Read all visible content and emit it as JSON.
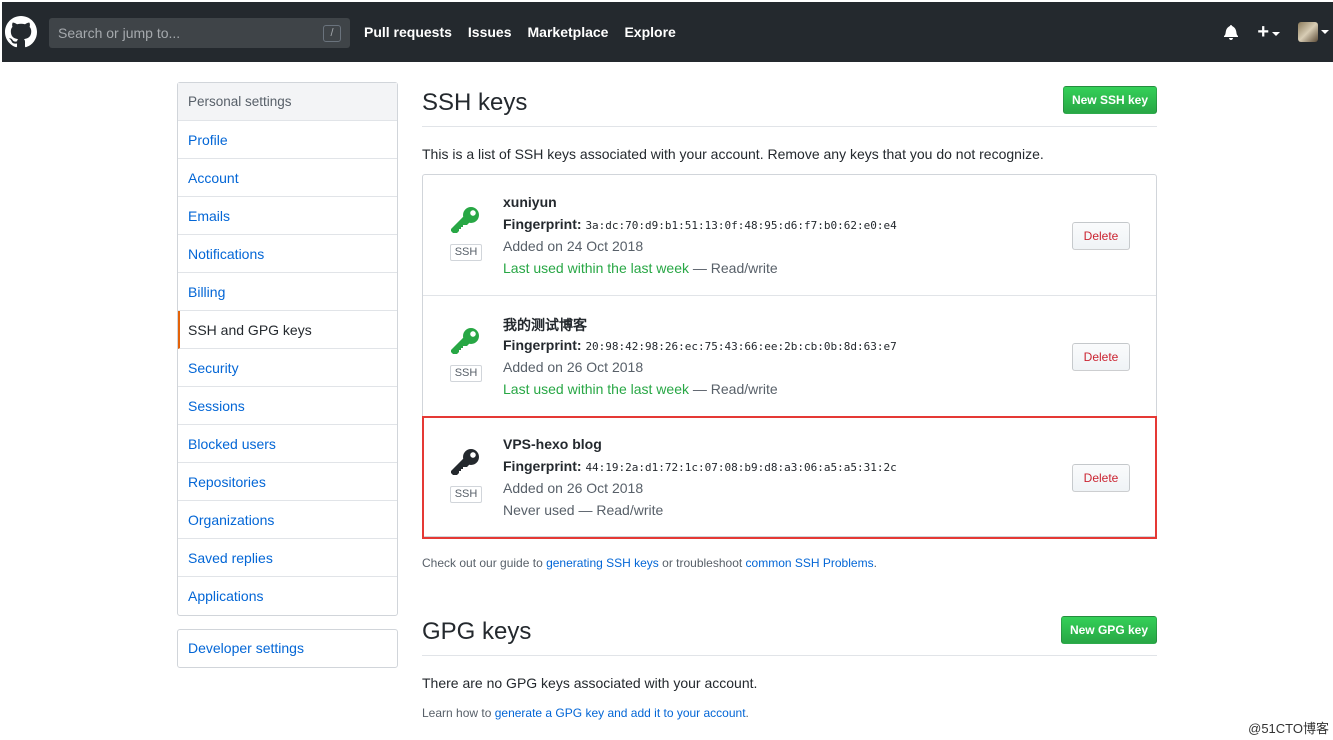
{
  "header": {
    "search_placeholder": "Search or jump to...",
    "slash_key": "/",
    "nav": [
      "Pull requests",
      "Issues",
      "Marketplace",
      "Explore"
    ],
    "plus_label": "+"
  },
  "sidebar": {
    "heading": "Personal settings",
    "items": [
      {
        "label": "Profile"
      },
      {
        "label": "Account"
      },
      {
        "label": "Emails"
      },
      {
        "label": "Notifications"
      },
      {
        "label": "Billing"
      },
      {
        "label": "SSH and GPG keys",
        "selected": true
      },
      {
        "label": "Security"
      },
      {
        "label": "Sessions"
      },
      {
        "label": "Blocked users"
      },
      {
        "label": "Repositories"
      },
      {
        "label": "Organizations"
      },
      {
        "label": "Saved replies"
      },
      {
        "label": "Applications"
      }
    ],
    "developer": "Developer settings"
  },
  "ssh": {
    "title": "SSH keys",
    "new_button": "New SSH key",
    "description": "This is a list of SSH keys associated with your account. Remove any keys that you do not recognize.",
    "badge": "SSH",
    "fingerprint_label": "Fingerprint:",
    "delete_label": "Delete",
    "keys": [
      {
        "title": "xuniyun",
        "fingerprint": "3a:dc:70:d9:b1:51:13:0f:48:95:d6:f7:b0:62:e0:e4",
        "added": "Added on 24 Oct 2018",
        "used": "Last used within the last week",
        "access": " — Read/write",
        "icon_color": "#28a745"
      },
      {
        "title": "我的测试博客",
        "fingerprint": "20:98:42:98:26:ec:75:43:66:ee:2b:cb:0b:8d:63:e7",
        "added": "Added on 26 Oct 2018",
        "used": "Last used within the last week",
        "access": " — Read/write",
        "icon_color": "#28a745"
      },
      {
        "title": "VPS-hexo blog",
        "fingerprint": "44:19:2a:d1:72:1c:07:08:b9:d8:a3:06:a5:a5:31:2c",
        "added": "Added on 26 Oct 2018",
        "used": "Never used — Read/write",
        "access": "",
        "icon_color": "#24292e"
      }
    ],
    "guide_prefix": "Check out our guide to ",
    "guide_link1": "generating SSH keys",
    "guide_middle": " or troubleshoot ",
    "guide_link2": "common SSH Problems",
    "guide_suffix": "."
  },
  "gpg": {
    "title": "GPG keys",
    "new_button": "New GPG key",
    "description": "There are no GPG keys associated with your account.",
    "learn_prefix": "Learn how to ",
    "learn_link": "generate a GPG key and add it to your account",
    "learn_suffix": "."
  },
  "watermark": "@51CTO博客",
  "colors": {
    "header_bg": "#24292e",
    "link": "#0366d6",
    "green": "#28a745",
    "danger": "#cb2431",
    "highlight": "#e53935"
  }
}
